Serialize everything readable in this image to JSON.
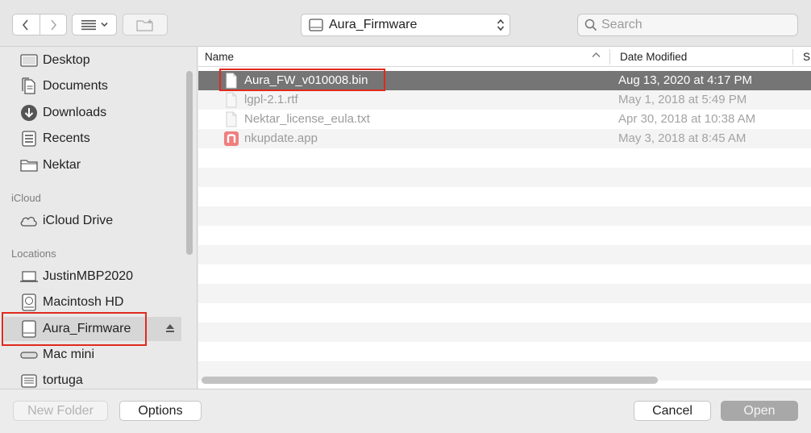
{
  "toolbar": {
    "location_label": "Aura_Firmware",
    "search_placeholder": "Search"
  },
  "sidebar": {
    "items_top": [
      {
        "label": "Desktop",
        "icon": "desktop-icon"
      },
      {
        "label": "Documents",
        "icon": "documents-icon"
      },
      {
        "label": "Downloads",
        "icon": "downloads-icon"
      },
      {
        "label": "Recents",
        "icon": "recents-icon"
      },
      {
        "label": "Nektar",
        "icon": "folder-icon"
      }
    ],
    "icloud_heading": "iCloud",
    "icloud_items": [
      {
        "label": "iCloud Drive",
        "icon": "cloud-icon"
      }
    ],
    "locations_heading": "Locations",
    "location_items": [
      {
        "label": "JustinMBP2020",
        "icon": "laptop-icon"
      },
      {
        "label": "Macintosh HD",
        "icon": "harddisk-icon"
      },
      {
        "label": "Aura_Firmware",
        "icon": "external-drive-icon"
      },
      {
        "label": "Mac mini",
        "icon": "mac-mini-icon"
      },
      {
        "label": "tortuga",
        "icon": "network-drive-icon"
      }
    ]
  },
  "filelist": {
    "col_name": "Name",
    "col_date": "Date Modified",
    "col_size": "S",
    "files": [
      {
        "name": "Aura_FW_v010008.bin",
        "date": "Aug 13, 2020 at 4:17 PM",
        "icon": "document-icon"
      },
      {
        "name": "lgpl-2.1.rtf",
        "date": "May 1, 2018 at 5:49 PM",
        "icon": "document-icon"
      },
      {
        "name": "Nektar_license_eula.txt",
        "date": "Apr 30, 2018 at 10:38 AM",
        "icon": "document-icon"
      },
      {
        "name": "nkupdate.app",
        "date": "May 3, 2018 at 8:45 AM",
        "icon": "app-icon"
      }
    ]
  },
  "bottom": {
    "new_folder": "New Folder",
    "options": "Options",
    "cancel": "Cancel",
    "open": "Open"
  },
  "colors": {
    "highlight_box": "#e02a1e",
    "selected_row": "#757575",
    "app_icon": "#f07e7e"
  }
}
